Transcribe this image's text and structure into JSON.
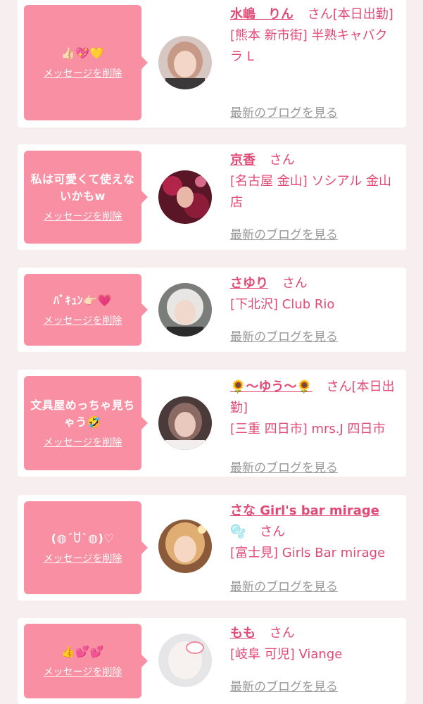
{
  "delete_label": "メッセージを削除",
  "blog_label": "最新のブログを見る",
  "honorific": "さん",
  "colors": {
    "bubble": "#f98fa2",
    "accent": "#e24a76",
    "muted": "#9a9a9a",
    "background": "#f7eef0"
  },
  "cards": [
    {
      "message": "👍🏻💖💛",
      "name": "水嶋　りん",
      "status": "[本日出勤]",
      "shop": "[熊本 新市街] 半熟キャバクラ L"
    },
    {
      "message": "私は可愛くて使えないかもw",
      "name": "京香",
      "status": "",
      "shop": "[名古屋 金山] ソシアル 金山店"
    },
    {
      "message": "ﾊﾞｷｭﾝ👉🏻💗",
      "name": "さゆり",
      "status": "",
      "shop": "[下北沢] Club Rio"
    },
    {
      "message": "文具屋めっちゃ見ちゃう🤣",
      "name": "🌻〜ゆう〜🌻",
      "status": "[本日出勤]",
      "shop": "[三重 四日市] mrs.J 四日市"
    },
    {
      "message": "(◍´ꇴ`◍)♡",
      "name": "さな Girl's bar mirage",
      "name_extra": "🫧",
      "status": "",
      "shop": "[富士見] Girls Bar mirage"
    },
    {
      "message": "👍💕💕",
      "name": "もも",
      "status": "",
      "shop": "[岐阜 可児] Viange"
    }
  ]
}
